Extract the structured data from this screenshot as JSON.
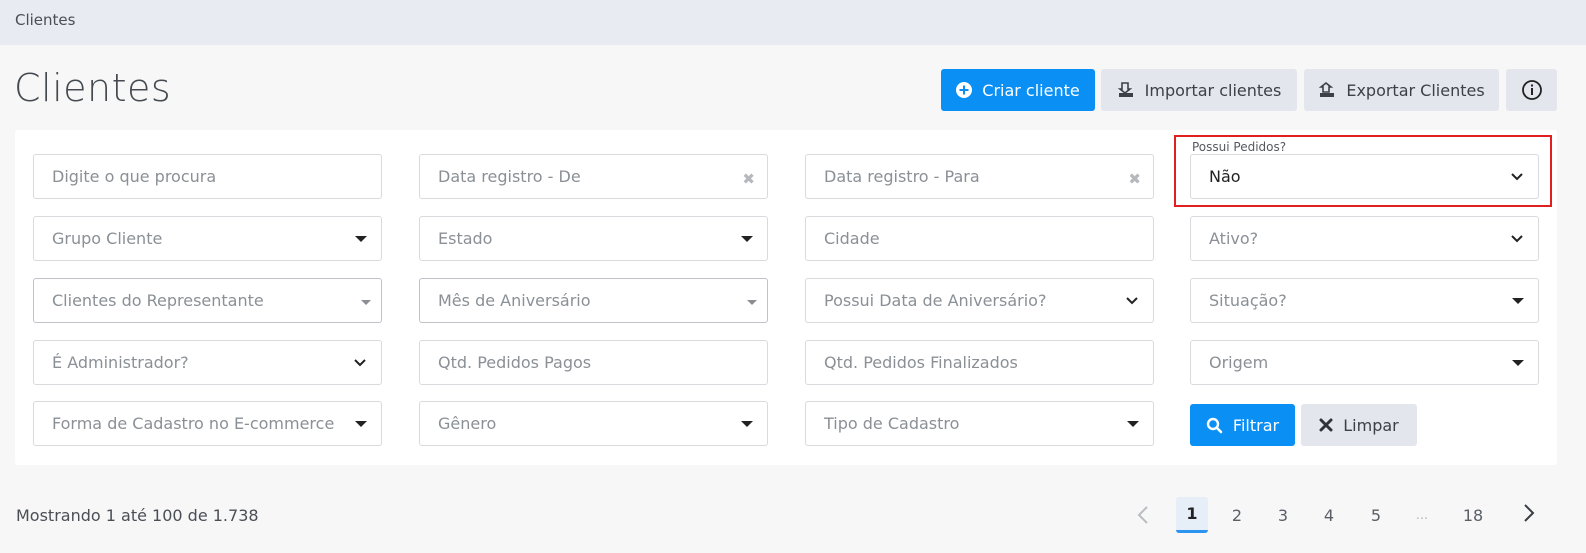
{
  "breadcrumb": "Clientes",
  "page_title": "Clientes",
  "actions": {
    "create": "Criar cliente",
    "import": "Importar clientes",
    "export": "Exportar Clientes"
  },
  "filters": {
    "search_placeholder": "Digite o que procura",
    "date_from": "Data registro - De",
    "date_to": "Data registro - Para",
    "possui_pedidos_label": "Possui Pedidos?",
    "possui_pedidos_value": "Não",
    "grupo_cliente": "Grupo Cliente",
    "estado": "Estado",
    "cidade": "Cidade",
    "ativo": "Ativo?",
    "clientes_representante": "Clientes do Representante",
    "mes_aniversario": "Mês de Aniversário",
    "possui_data_aniversario": "Possui Data de Aniversário?",
    "situacao": "Situação?",
    "e_administrador": "É Administrador?",
    "qtd_pedidos_pagos": "Qtd. Pedidos Pagos",
    "qtd_pedidos_finalizados": "Qtd. Pedidos Finalizados",
    "origem": "Origem",
    "forma_cadastro": "Forma de Cadastro no E-commerce",
    "genero": "Gênero",
    "tipo_cadastro": "Tipo de Cadastro",
    "filter_button": "Filtrar",
    "clear_button": "Limpar"
  },
  "showing_text": "Mostrando 1 até 100 de 1.738",
  "pagination": {
    "pages": [
      "1",
      "2",
      "3",
      "4",
      "5",
      "...",
      "18"
    ],
    "active": "1"
  },
  "colors": {
    "primary": "#0a8ff5",
    "highlight": "#e0201f"
  }
}
